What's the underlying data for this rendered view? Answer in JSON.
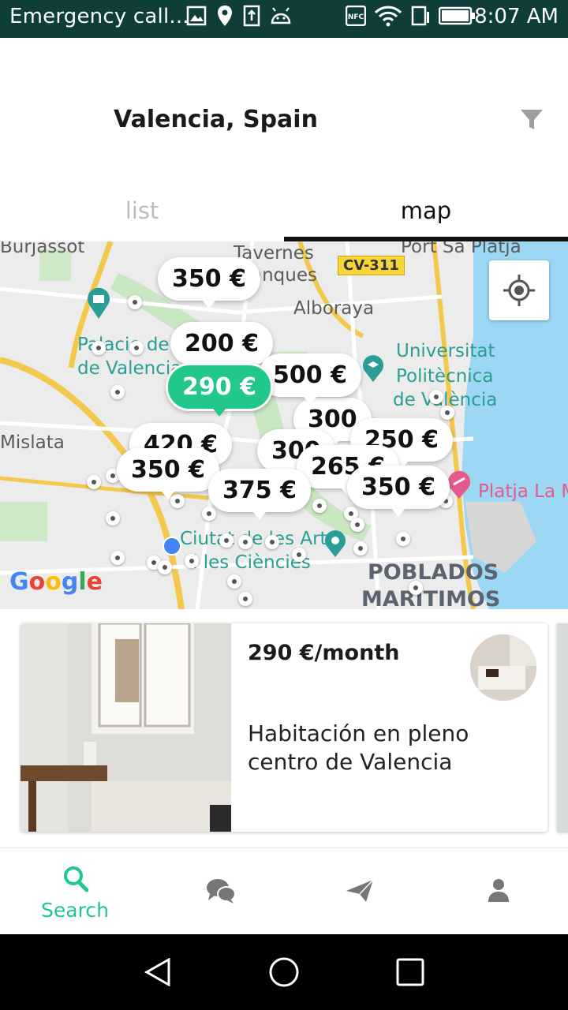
{
  "status_bar": {
    "title": "Emergency call...",
    "time": "8:07 AM",
    "icons": [
      "image-icon",
      "location-icon",
      "upload-icon",
      "android-icon",
      "nfc-icon",
      "wifi-icon",
      "sim-icon",
      "battery-icon"
    ],
    "background": "#0f3d3a"
  },
  "header": {
    "location": "Valencia, Spain",
    "tabs": [
      {
        "label": "list",
        "active": false
      },
      {
        "label": "map",
        "active": true
      }
    ]
  },
  "map": {
    "labels": {
      "burjassot": "Burjassot",
      "tavernes": "Tavernes",
      "blanques": "anques",
      "port_sa_platja": "Port Sa Platja",
      "alboraya": "Alboraya",
      "palau1": "Palacio de",
      "palau2": "de Valencia",
      "universitat1": "Universitat",
      "universitat2": "Politècnica",
      "universitat3": "de València",
      "mislata": "Mislata",
      "ciutat1": "Ciutat de les Arts",
      "ciutat2": "i les Ciències",
      "platja": "Platja La M",
      "poblados1": "POBLADOS",
      "poblados2": "MARÍTIMOS"
    },
    "road_shield": "CV-311",
    "google": "Google",
    "pins": [
      {
        "label": "350 €",
        "active": false
      },
      {
        "label": "200 €",
        "active": false
      },
      {
        "label": "500 €",
        "active": false
      },
      {
        "label": "290 €",
        "active": true
      },
      {
        "label": "300",
        "active": false
      },
      {
        "label": "250 €",
        "active": false
      },
      {
        "label": "420 €",
        "active": false
      },
      {
        "label": "300",
        "active": false
      },
      {
        "label": "265 €",
        "active": false
      },
      {
        "label": "350 €",
        "active": false
      },
      {
        "label": "375 €",
        "active": false
      },
      {
        "label": "350 €",
        "active": false
      }
    ]
  },
  "listing": {
    "price": "290 €/month",
    "title": "Habitación en pleno centro de Valencia"
  },
  "bottom_nav": {
    "items": [
      {
        "name": "search",
        "label": "Search",
        "icon": "search-icon",
        "active": true
      },
      {
        "name": "messages",
        "label": "",
        "icon": "chat-icon",
        "active": false
      },
      {
        "name": "send",
        "label": "",
        "icon": "send-icon",
        "active": false
      },
      {
        "name": "profile",
        "label": "",
        "icon": "person-icon",
        "active": false
      }
    ],
    "accent": "#22c78a"
  },
  "android_nav": [
    "back-icon",
    "home-icon",
    "recents-icon"
  ]
}
